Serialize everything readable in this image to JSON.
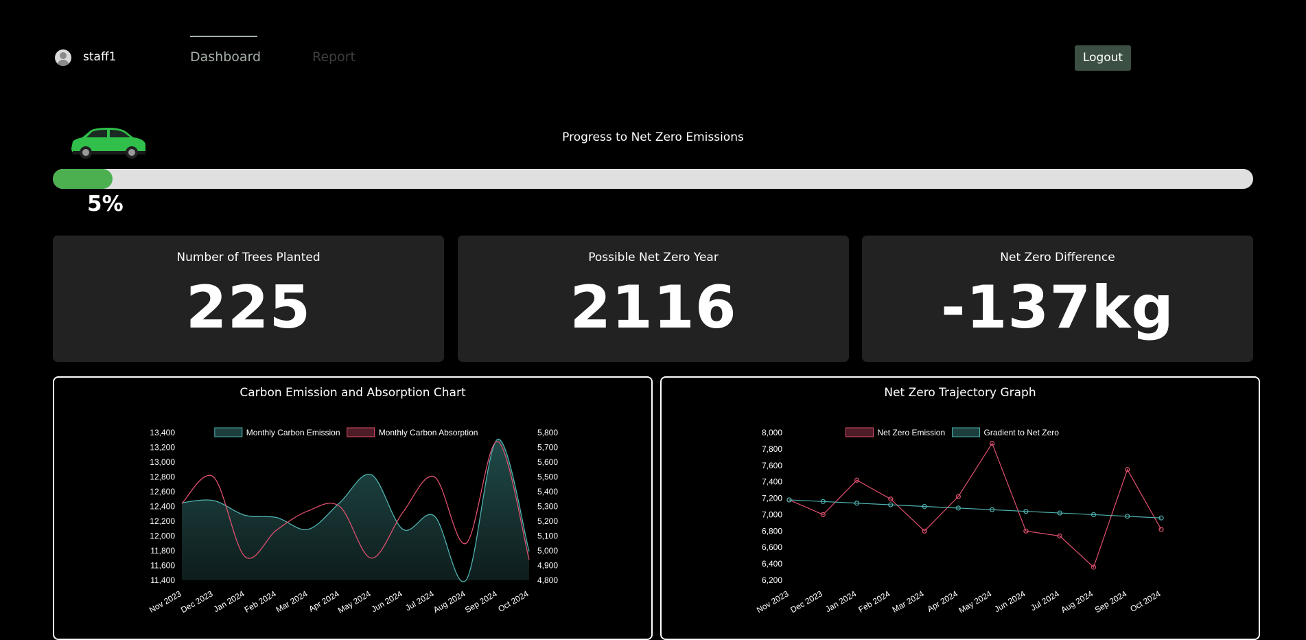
{
  "nav": {
    "username": "staff1",
    "tabs": [
      {
        "label": "Dashboard"
      },
      {
        "label": "Report"
      }
    ],
    "logout_label": "Logout"
  },
  "progress": {
    "title": "Progress to Net Zero Emissions",
    "value": 0.05,
    "label": "5%",
    "fill_color": "#4caf50"
  },
  "cards": [
    {
      "label": "Number of Trees Planted",
      "value": "225"
    },
    {
      "label": "Possible Net Zero Year",
      "value": "2116"
    },
    {
      "label": "Net Zero Difference",
      "value": "-137kg"
    }
  ],
  "chart_data": [
    {
      "type": "area",
      "title": "Carbon Emission and Absorption Chart",
      "categories": [
        "Nov 2023",
        "Dec 2023",
        "Jan 2024",
        "Feb 2024",
        "Mar 2024",
        "Apr 2024",
        "May 2024",
        "Jun 2024",
        "Jul 2024",
        "Aug 2024",
        "Sep 2024",
        "Oct 2024"
      ],
      "series": [
        {
          "name": "Monthly Carbon Emission",
          "axis": "left",
          "fill": true,
          "color": "#4fb3b0",
          "values": [
            12450,
            12480,
            12280,
            12250,
            12090,
            12450,
            12830,
            12090,
            12270,
            11400,
            13310,
            11790
          ]
        },
        {
          "name": "Monthly Carbon Absorption",
          "axis": "right",
          "fill": false,
          "color": "#e0506e",
          "values": [
            5320,
            5500,
            4960,
            5140,
            5270,
            5300,
            4950,
            5260,
            5500,
            5050,
            5740,
            4940
          ]
        }
      ],
      "y_left": {
        "min": 11400,
        "max": 13400,
        "ticks": [
          "13,400",
          "13,200",
          "13,000",
          "12,800",
          "12,600",
          "12,400",
          "12,200",
          "12,000",
          "11,800",
          "11,600",
          "11,400"
        ]
      },
      "y_right": {
        "min": 4800,
        "max": 5800,
        "ticks": [
          "5,800",
          "5,700",
          "5,600",
          "5,500",
          "5,400",
          "5,300",
          "5,200",
          "5,100",
          "5,000",
          "4,900",
          "4,800"
        ]
      },
      "legend": "top"
    },
    {
      "type": "line",
      "title": "Net Zero Trajectory Graph",
      "categories": [
        "Nov 2023",
        "Dec 2023",
        "Jan 2024",
        "Feb 2024",
        "Mar 2024",
        "Apr 2024",
        "May 2024",
        "Jun 2024",
        "Jul 2024",
        "Aug 2024",
        "Sep 2024",
        "Oct 2024"
      ],
      "series": [
        {
          "name": "Net Zero Emission",
          "color": "#e0506e",
          "values": [
            7180,
            7000,
            7420,
            7190,
            6800,
            7220,
            7870,
            6800,
            6740,
            6360,
            7550,
            6820
          ]
        },
        {
          "name": "Gradient to Net Zero",
          "color": "#4fb3b0",
          "values": [
            7180,
            7160,
            7140,
            7120,
            7100,
            7080,
            7060,
            7040,
            7020,
            7000,
            6980,
            6960
          ]
        }
      ],
      "y": {
        "min": 6200,
        "max": 8000,
        "ticks": [
          "8,000",
          "7,800",
          "7,600",
          "7,400",
          "7,200",
          "7,000",
          "6,800",
          "6,600",
          "6,400",
          "6,200"
        ]
      },
      "legend": "top"
    }
  ]
}
